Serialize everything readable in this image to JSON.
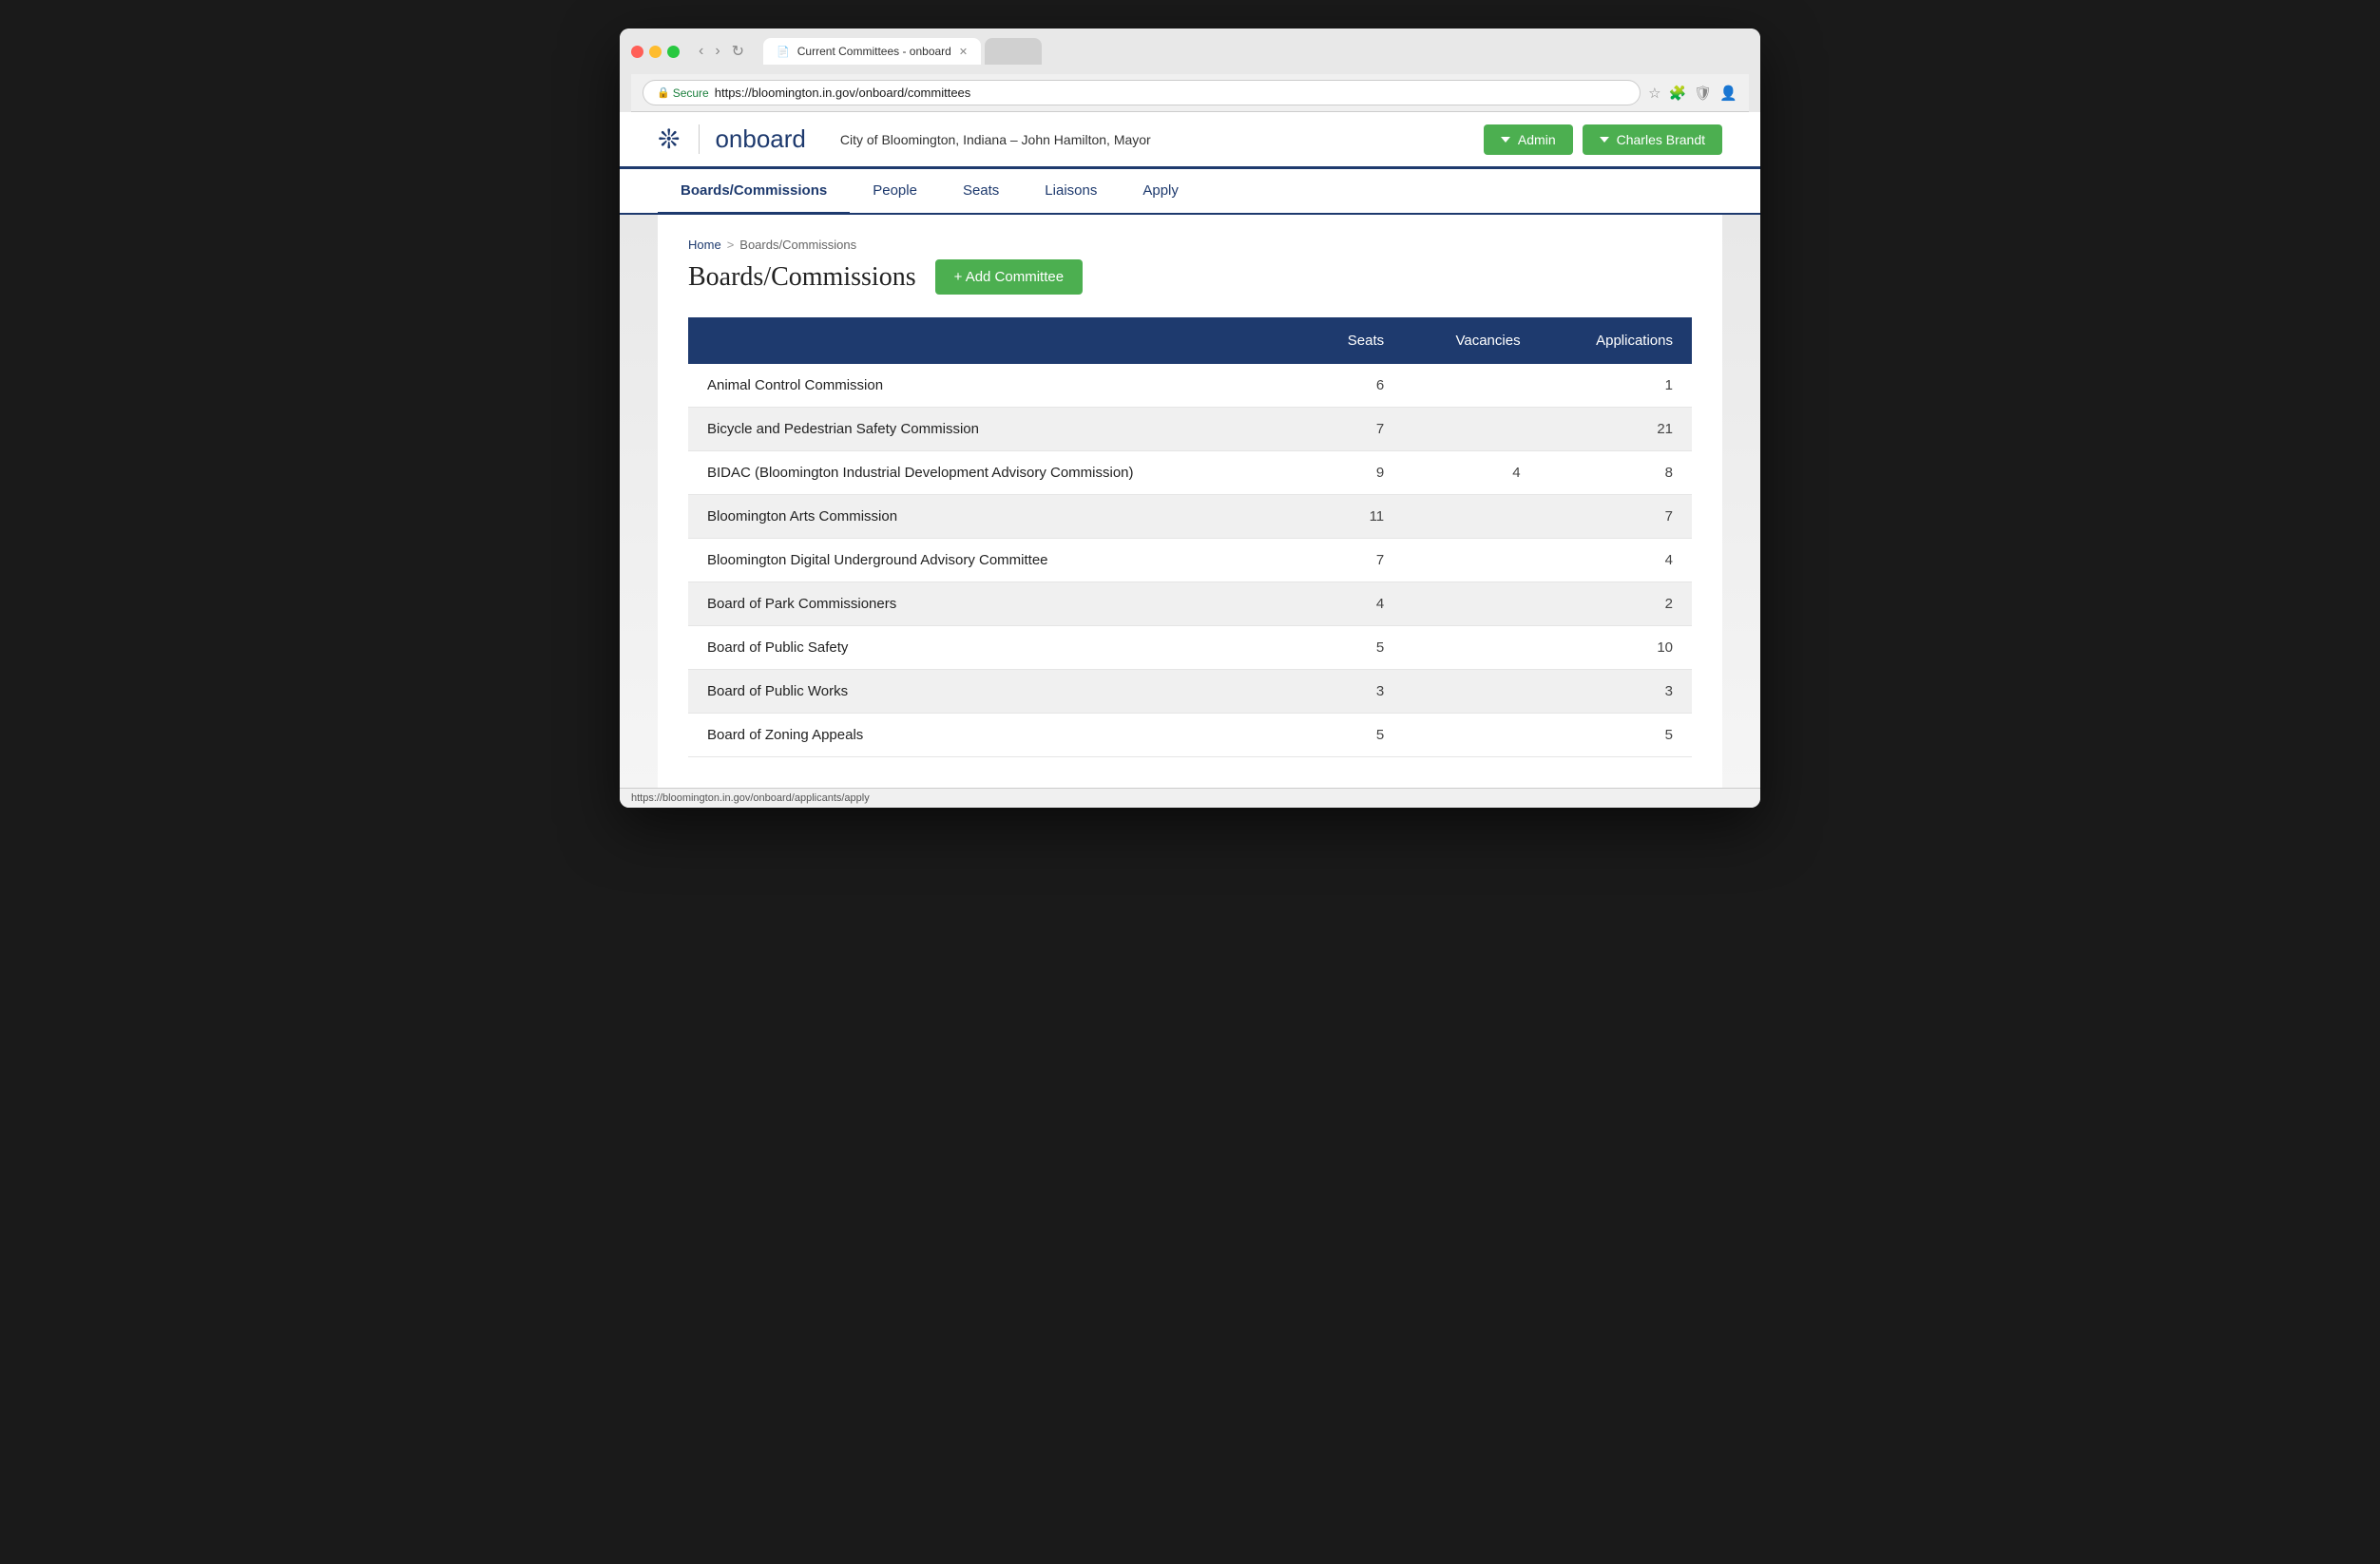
{
  "browser": {
    "tab_title": "Current Committees - onboard",
    "url_secure_label": "Secure",
    "url": "https://bloomington.in.gov/onboard/committees",
    "status_bar_url": "https://bloomington.in.gov/onboard/applicants/apply"
  },
  "header": {
    "logo_text": "onboard",
    "site_title": "City of Bloomington, Indiana – John Hamilton, Mayor",
    "admin_button": "Admin",
    "user_button": "Charles Brandt"
  },
  "nav": {
    "items": [
      {
        "label": "Boards/Commissions",
        "active": true
      },
      {
        "label": "People",
        "active": false
      },
      {
        "label": "Seats",
        "active": false
      },
      {
        "label": "Liaisons",
        "active": false
      },
      {
        "label": "Apply",
        "active": false
      }
    ]
  },
  "breadcrumb": {
    "home": "Home",
    "separator": ">",
    "current": "Boards/Commissions"
  },
  "page": {
    "title": "Boards/Commissions",
    "add_button": "+ Add Committee"
  },
  "table": {
    "headers": {
      "name": "",
      "seats": "Seats",
      "vacancies": "Vacancies",
      "applications": "Applications"
    },
    "rows": [
      {
        "name": "Animal Control Commission",
        "seats": "6",
        "vacancies": "",
        "applications": "1"
      },
      {
        "name": "Bicycle and Pedestrian Safety Commission",
        "seats": "7",
        "vacancies": "",
        "applications": "21"
      },
      {
        "name": "BIDAC (Bloomington Industrial Development Advisory Commission)",
        "seats": "9",
        "vacancies": "4",
        "applications": "8"
      },
      {
        "name": "Bloomington Arts Commission",
        "seats": "11",
        "vacancies": "",
        "applications": "7"
      },
      {
        "name": "Bloomington Digital Underground Advisory Committee",
        "seats": "7",
        "vacancies": "",
        "applications": "4"
      },
      {
        "name": "Board of Park Commissioners",
        "seats": "4",
        "vacancies": "",
        "applications": "2"
      },
      {
        "name": "Board of Public Safety",
        "seats": "5",
        "vacancies": "",
        "applications": "10"
      },
      {
        "name": "Board of Public Works",
        "seats": "3",
        "vacancies": "",
        "applications": "3"
      },
      {
        "name": "Board of Zoning Appeals",
        "seats": "5",
        "vacancies": "",
        "applications": "5"
      }
    ]
  }
}
